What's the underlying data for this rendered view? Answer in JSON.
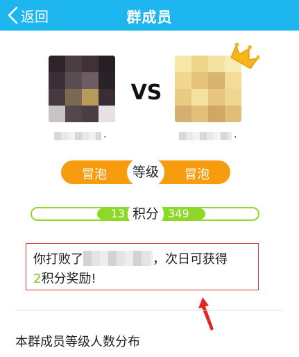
{
  "header": {
    "back_label": "返回",
    "title": "群成员",
    "bg_color": "#1eb6ee"
  },
  "vs": {
    "label": "VS",
    "left_name_suffix": ".",
    "right_name_suffix": "."
  },
  "level": {
    "label": "等级",
    "left_value": "冒泡",
    "right_value": "冒泡",
    "bar_color": "#f79c0f"
  },
  "score": {
    "label": "积分",
    "left_value": "13",
    "right_value": "349",
    "bar_color": "#8ed82a"
  },
  "message": {
    "line1_prefix": "你打败了",
    "line1_suffix": "，次日可获得",
    "reward_points": "2",
    "line2_suffix": "积分奖励!",
    "box_color": "#d9383a"
  },
  "section": {
    "title": "本群成员等级人数分布"
  }
}
